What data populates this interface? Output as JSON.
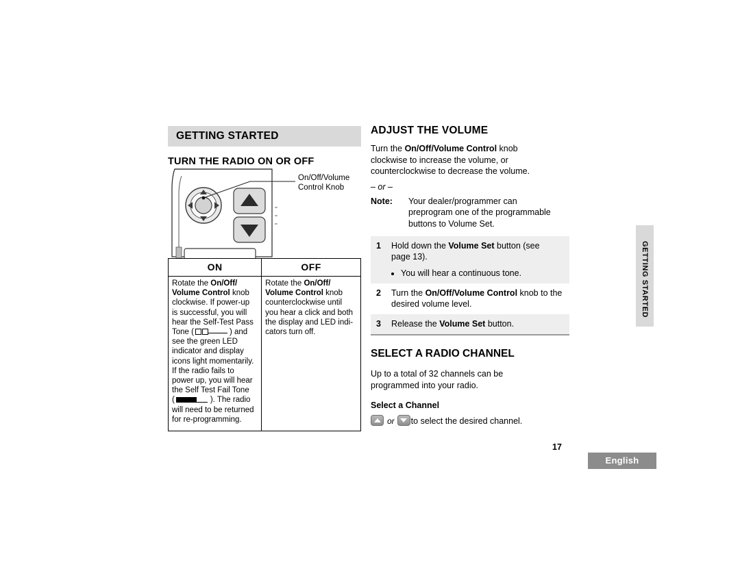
{
  "left": {
    "banner": "GETTING STARTED",
    "subhead": "TURN THE RADIO ON OR OFF",
    "callout": "On/Off/Volume\nControl Knob",
    "callout_line1": "On/Off/Volume",
    "callout_line2": "Control Knob",
    "table": {
      "headers": [
        "ON",
        "OFF"
      ],
      "on_cell": {
        "l1": "Rotate the ",
        "b1": "On/Off/",
        "b2": "Volume Control",
        "l2": " knob",
        "l3": "clockwise. If power-up",
        "l4": "is successful, you will",
        "l5": "hear the Self-Test Pass",
        "l6a": "Tone (",
        "l6b": ") and",
        "l7": "see the green LED",
        "l8": "indicator and display",
        "l9": "icons light momentarily.",
        "l10": "If the radio fails to",
        "l11": "power up, you will hear",
        "l12": "the Self Test Fail Tone",
        "l13a": "(",
        "l13b": "). The radio",
        "l14": "will need to be returned",
        "l15": "for re-programming."
      },
      "off_cell": {
        "l1": "Rotate the ",
        "b1": "On/Off/",
        "b2": "Volume Control",
        "l2": " knob",
        "l3": "counterclockwise until",
        "l4": "you hear a click and both",
        "l5": "the display and LED indi-",
        "l6": "cators turn off."
      }
    }
  },
  "right": {
    "head_volume": "ADJUST THE VOLUME",
    "volume_para": {
      "p1": "Turn the ",
      "b1": "On/Off/Volume Control",
      "p2": " knob",
      "p3": "clockwise to increase the volume, or",
      "p4": "counterclockwise to decrease the volume."
    },
    "or_dash": "– or –",
    "note_label": "Note:",
    "note_body": {
      "l1": "Your dealer/programmer can",
      "l2": "preprogram one of the programmable",
      "l3": "buttons to Volume Set."
    },
    "steps": [
      {
        "num": "1",
        "pre": "Hold down the ",
        "bold": "Volume Set",
        "post": " button (see",
        "line2": "page 13)."
      },
      {
        "num": "2",
        "pre": "Turn the ",
        "bold": "On/Off/Volume Control",
        "post": " knob to the",
        "line2": "desired volume level."
      },
      {
        "num": "3",
        "pre": "Release the ",
        "bold": "Volume Set",
        "post": " button.",
        "line2": ""
      }
    ],
    "step1_bullet": "You will hear a continuous tone.",
    "head_channel": "SELECT A RADIO CHANNEL",
    "channel_para": {
      "l1": "Up to a total of 32 channels can be",
      "l2": "programmed into your radio."
    },
    "select_channel_head": "Select a Channel",
    "select_channel_or": "or",
    "select_channel_tail": "to select the desired channel."
  },
  "side_tab": "GETTING STARTED",
  "footer": {
    "page_number": "17",
    "language": "English"
  }
}
